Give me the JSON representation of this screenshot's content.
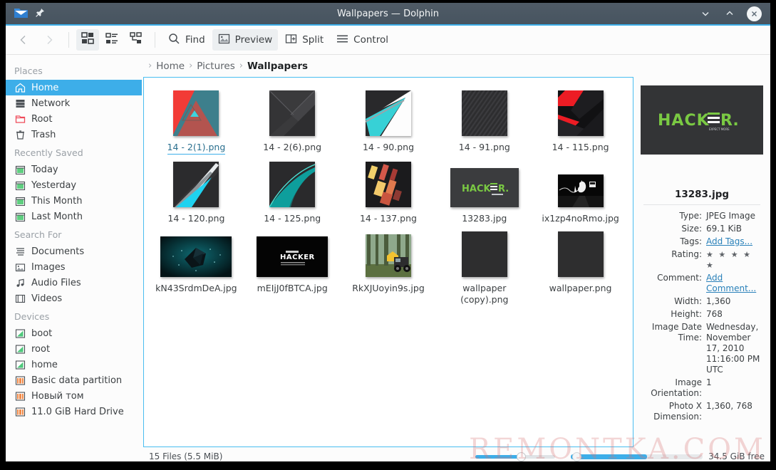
{
  "window": {
    "title": "Wallpapers — Dolphin",
    "app_icon": "folder-icon",
    "pin_icon": "pin-icon",
    "minimize_icon": "chevron-down-icon",
    "maximize_icon": "chevron-up-icon",
    "close_icon": "close-icon",
    "accent_color": "#3daee9",
    "titlebar_color": "#4b5762"
  },
  "toolbar": {
    "back_label": "Back",
    "forward_label": "Forward",
    "view_icons_label": "Icons",
    "view_compact_label": "Compact",
    "view_details_label": "Details",
    "find_label": "Find",
    "preview_label": "Preview",
    "split_label": "Split",
    "control_label": "Control"
  },
  "sidebar": {
    "groups": [
      {
        "title": "Places",
        "items": [
          {
            "label": "Home",
            "icon": "home-icon",
            "selected": true
          },
          {
            "label": "Network",
            "icon": "network-icon",
            "selected": false
          },
          {
            "label": "Root",
            "icon": "root-folder-icon",
            "selected": false
          },
          {
            "label": "Trash",
            "icon": "trash-icon",
            "selected": false
          }
        ]
      },
      {
        "title": "Recently Saved",
        "items": [
          {
            "label": "Today",
            "icon": "calendar-icon",
            "selected": false
          },
          {
            "label": "Yesterday",
            "icon": "calendar-icon",
            "selected": false
          },
          {
            "label": "This Month",
            "icon": "calendar-icon",
            "selected": false
          },
          {
            "label": "Last Month",
            "icon": "calendar-icon",
            "selected": false
          }
        ]
      },
      {
        "title": "Search For",
        "items": [
          {
            "label": "Documents",
            "icon": "document-icon",
            "selected": false
          },
          {
            "label": "Images",
            "icon": "image-icon",
            "selected": false
          },
          {
            "label": "Audio Files",
            "icon": "audio-icon",
            "selected": false
          },
          {
            "label": "Videos",
            "icon": "video-icon",
            "selected": false
          }
        ]
      },
      {
        "title": "Devices",
        "items": [
          {
            "label": "boot",
            "icon": "drive-green-icon",
            "selected": false
          },
          {
            "label": "root",
            "icon": "drive-green-icon",
            "selected": false
          },
          {
            "label": "home",
            "icon": "drive-green-icon",
            "selected": false
          },
          {
            "label": "Basic data partition",
            "icon": "drive-orange-icon",
            "selected": false
          },
          {
            "label": "Новый том",
            "icon": "drive-orange-icon",
            "selected": false
          },
          {
            "label": "11.0 GiB Hard Drive",
            "icon": "drive-orange-icon",
            "selected": false
          }
        ]
      }
    ]
  },
  "breadcrumb": {
    "separator": "›",
    "items": [
      "Home",
      "Pictures",
      "Wallpapers"
    ]
  },
  "files": [
    {
      "name": "14 - 2(1).png",
      "thumb": "geo-red-teal",
      "hovered": true
    },
    {
      "name": "14 - 2(6).png",
      "thumb": "dark-diagonal",
      "hovered": false
    },
    {
      "name": "14 - 90.png",
      "thumb": "teal-white-wedge",
      "hovered": false
    },
    {
      "name": "14 - 91.png",
      "thumb": "dark-stripes",
      "hovered": false
    },
    {
      "name": "14 - 115.png",
      "thumb": "red-black-bands",
      "hovered": false
    },
    {
      "name": "14 - 120.png",
      "thumb": "cyan-beam",
      "hovered": false
    },
    {
      "name": "14 - 125.png",
      "thumb": "teal-swoosh",
      "hovered": false
    },
    {
      "name": "14 - 137.png",
      "thumb": "orange-blocks",
      "hovered": false
    },
    {
      "name": "13283.jpg",
      "thumb": "hacker-green",
      "hovered": false
    },
    {
      "name": "ix1zp4noRmo.jpg",
      "thumb": "road-night",
      "hovered": false
    },
    {
      "name": "kN43SrdmDeA.jpg",
      "thumb": "teal-polygon",
      "hovered": false
    },
    {
      "name": "mEIjJ0fBTCA.jpg",
      "thumb": "hacker-white",
      "hovered": false
    },
    {
      "name": "RkXJUoyin9s.jpg",
      "thumb": "forest-jeep",
      "hovered": false
    },
    {
      "name": "wallpaper (copy).png",
      "thumb": "plain-dark",
      "hovered": false
    },
    {
      "name": "wallpaper.png",
      "thumb": "plain-dark",
      "hovered": false
    }
  ],
  "info_panel": {
    "preview_logo": "HACKER",
    "preview_sub": "EXPECT MORE",
    "filename": "13283.jpg",
    "rows": [
      {
        "key": "Type:",
        "value": "JPEG Image",
        "link": false
      },
      {
        "key": "Size:",
        "value": "69.1 KiB",
        "link": false
      },
      {
        "key": "Tags:",
        "value": "Add Tags...",
        "link": true
      },
      {
        "key": "Rating:",
        "value": "★ ★ ★ ★ ★",
        "link": false
      },
      {
        "key": "Comment:",
        "value": "Add Comment...",
        "link": true
      },
      {
        "key": "Width:",
        "value": "1,360",
        "link": false
      },
      {
        "key": "Height:",
        "value": "768",
        "link": false
      },
      {
        "key": "Image Date Time:",
        "value": "Wednesday, November 17, 2010 11:16:00 PM UTC",
        "link": false
      },
      {
        "key": "Image Orientation:",
        "value": "1",
        "link": false
      },
      {
        "key": "Photo X Dimension:",
        "value": "1,360, 768",
        "link": false
      }
    ]
  },
  "statusbar": {
    "count_text": "15 Files (5.5 MiB)",
    "free_text": "34.5 GiB free"
  },
  "watermark": {
    "text": "REMONTKA.COM"
  }
}
